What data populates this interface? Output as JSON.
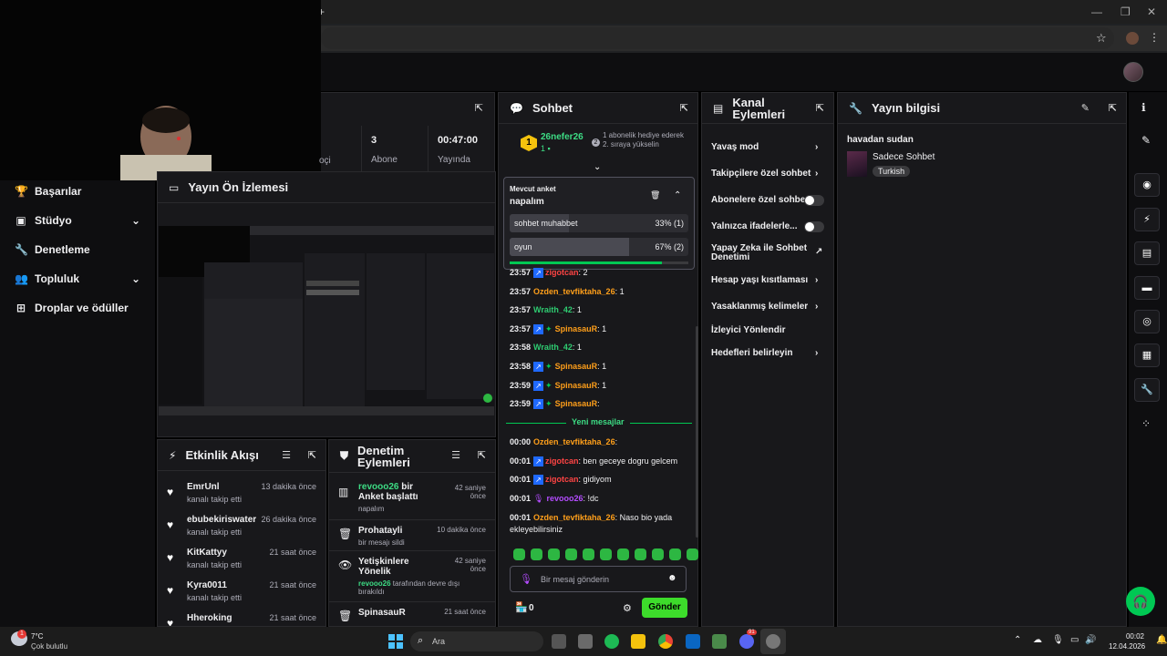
{
  "browser": {
    "add_tab": "+",
    "minimize": "—",
    "restore": "❐",
    "close": "✕",
    "bookmark_icon": "☆",
    "menu_icon": "⋮"
  },
  "sidebar": {
    "items": [
      {
        "label": "Başarılar",
        "icon": "trophy-icon",
        "has_chevron": false
      },
      {
        "label": "Stüdyo",
        "icon": "studio-icon",
        "has_chevron": true
      },
      {
        "label": "Denetleme",
        "icon": "wrench-icon",
        "has_chevron": false
      },
      {
        "label": "Topluluk",
        "icon": "community-icon",
        "has_chevron": true
      },
      {
        "label": "Droplar ve ödüller",
        "icon": "drops-icon",
        "has_chevron": false
      }
    ]
  },
  "stats": {
    "cell1_label": "oçi",
    "cell2_num": "3",
    "cell2_label": "Abone",
    "cell3_num": "00:47:00",
    "cell3_label": "Yayında"
  },
  "preview": {
    "title": "Yayın Ön İzlemesi"
  },
  "activity": {
    "title": "Etkinlik Akışı",
    "items": [
      {
        "name": "EmrUnl",
        "sub": "kanalı takip etti",
        "time": "13 dakika önce"
      },
      {
        "name": "ebubekiriswater",
        "sub": "kanalı takip etti",
        "time": "26 dakika önce"
      },
      {
        "name": "KitKattyy",
        "sub": "kanalı takip etti",
        "time": "21 saat önce"
      },
      {
        "name": "Kyra0011",
        "sub": "kanalı takip etti",
        "time": "21 saat önce"
      },
      {
        "name": "Hheroking",
        "sub": "",
        "time": "21 saat önce"
      }
    ]
  },
  "modlog": {
    "title_line1": "Denetim",
    "title_line2": "Eylemleri",
    "items": [
      {
        "user": "revooo26",
        "title": " bir Anket başlattı",
        "sub": "napalım",
        "time": "42 saniye önce"
      },
      {
        "user": "",
        "title": "Prohatayli",
        "sub": "bir mesajı sildi",
        "time": "10 dakika önce"
      },
      {
        "user": "",
        "title": "Yetişkinlere Yönelik",
        "sub_user": "revooo26",
        "sub": " tarafından devre dışı bırakıldı",
        "time": "42 saniye önce"
      },
      {
        "user": "",
        "title": "SpinasauR",
        "sub": "",
        "time": "21 saat önce"
      }
    ]
  },
  "chat": {
    "title": "Sohbet",
    "leader": {
      "rank": "1",
      "name": "26nefer26",
      "count": "1",
      "badge_num": "2",
      "note": "1 abonelik hediye ederek 2. sıraya yükselin"
    },
    "poll": {
      "header": "Mevcut anket",
      "question": "napalım",
      "options": [
        {
          "label": "sohbet muhabbet",
          "result": "33% (1)",
          "fraction": 0.33
        },
        {
          "label": "oyun",
          "result": "67% (2)",
          "fraction": 0.67
        }
      ],
      "time_remaining_fraction": 0.85
    },
    "messages": [
      {
        "time": "23:57",
        "badges": [
          "prime"
        ],
        "user": "zigotcan",
        "color": "#ff4444",
        "text": ": 2"
      },
      {
        "time": "23:57",
        "badges": [],
        "user": "Ozden_tevfiktaha_26",
        "color": "#ff9f1a",
        "text": ": 1"
      },
      {
        "time": "23:57",
        "badges": [],
        "user": "Wraith_42",
        "color": "#2ecc71",
        "text": ": 1"
      },
      {
        "time": "23:57",
        "badges": [
          "prime",
          "gem"
        ],
        "user": "SpinasauR",
        "color": "#ff9f1a",
        "text": ": 1"
      },
      {
        "time": "23:58",
        "badges": [],
        "user": "Wraith_42",
        "color": "#2ecc71",
        "text": ": 1"
      },
      {
        "time": "23:58",
        "badges": [
          "prime",
          "gem"
        ],
        "user": "SpinasauR",
        "color": "#ff9f1a",
        "text": ": 1"
      },
      {
        "time": "23:59",
        "badges": [
          "prime",
          "gem"
        ],
        "user": "SpinasauR",
        "color": "#ff9f1a",
        "text": ": 1"
      },
      {
        "time": "23:59",
        "badges": [
          "prime",
          "gem"
        ],
        "user": "SpinasauR",
        "color": "#ff9f1a",
        "text": ":"
      }
    ],
    "new_messages_label": "Yeni mesajlar",
    "new_messages": [
      {
        "time": "00:00",
        "badges": [],
        "user": "Ozden_tevfiktaha_26",
        "color": "#ff9f1a",
        "text": ":"
      },
      {
        "time": "00:01",
        "badges": [
          "prime"
        ],
        "user": "zigotcan",
        "color": "#ff4444",
        "text": ": ben geceye dogru gelcem"
      },
      {
        "time": "00:01",
        "badges": [
          "prime"
        ],
        "user": "zigotcan",
        "color": "#ff4444",
        "text": ": gidiyom"
      },
      {
        "time": "00:01",
        "badges": [
          "mic"
        ],
        "user": "revooo26",
        "color": "#b44cff",
        "text": ": !dc"
      },
      {
        "time": "00:01",
        "badges": [],
        "user": "Ozden_tevfiktaha_26",
        "color": "#ff9f1a",
        "text": ": Naso bio yada ekleyebilirsiniz"
      }
    ],
    "input_placeholder": "Bir mesaj gönderin",
    "points": "0",
    "send_label": "Gönder"
  },
  "channel_actions": {
    "title_line1": "Kanal",
    "title_line2": "Eylemleri",
    "items": [
      {
        "label": "Yavaş mod",
        "control": "chevron"
      },
      {
        "label": "Takipçilere özel sohbet",
        "control": "chevron"
      },
      {
        "label": "Abonelere özel sohbet",
        "control": "toggle"
      },
      {
        "label": "Yalnızca ifadelerle...",
        "control": "toggle"
      },
      {
        "label": "Yapay Zeka ile Sohbet Denetimi",
        "control": "external"
      },
      {
        "label": "Hesap yaşı kısıtlaması",
        "control": "chevron"
      },
      {
        "label": "Yasaklanmış kelimeler",
        "control": "chevron"
      },
      {
        "label": "İzleyici Yönlendir",
        "control": "none"
      },
      {
        "label": "Hedefleri belirleyin",
        "control": "chevron"
      }
    ]
  },
  "stream_info": {
    "title": "Yayın bilgisi",
    "stream_title": "havadan sudan",
    "category": "Sadece Sohbet",
    "tag": "Turkish"
  },
  "taskbar": {
    "weather_temp": "7°C",
    "weather_desc": "Çok bulutlu",
    "weather_badge": "1",
    "search_label": "Ara",
    "time": "00:02",
    "date": "12.04.2026",
    "discord_badge": "91"
  },
  "colors": {
    "accent_green": "#00f593",
    "twitch_purple": "#9147ff",
    "send_green": "#3ddc2b"
  }
}
